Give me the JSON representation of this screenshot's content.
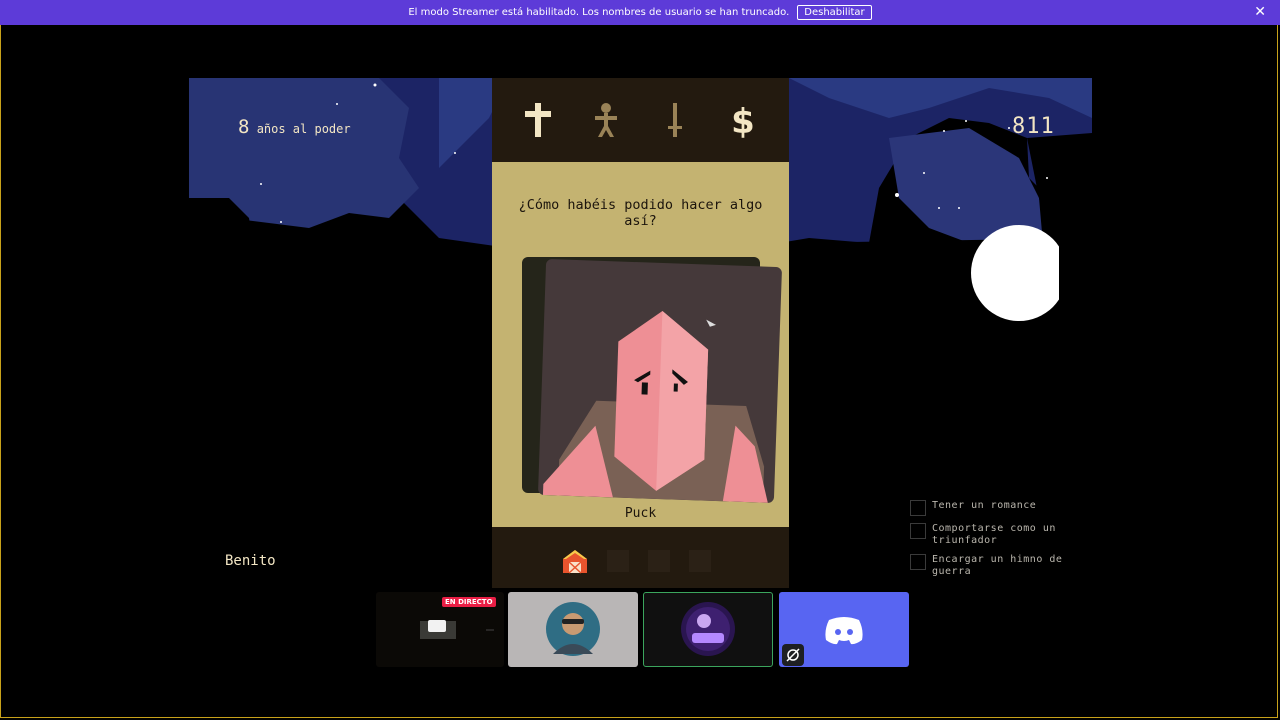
{
  "banner": {
    "message": "El modo Streamer está habilitado. Los nombres de usuario se han truncado.",
    "disable_label": "Deshabilitar",
    "close_icon": "close-icon",
    "color": "#5d3bd8"
  },
  "hud": {
    "years_number": "8",
    "years_label": "años al poder",
    "score": "811"
  },
  "stats": [
    {
      "name": "church",
      "icon": "cross-icon"
    },
    {
      "name": "people",
      "icon": "person-icon"
    },
    {
      "name": "army",
      "icon": "sword-icon"
    },
    {
      "name": "money",
      "icon": "dollar-icon"
    }
  ],
  "card": {
    "question": "¿Cómo habéis podido hacer algo así?",
    "character_name": "Puck"
  },
  "player": {
    "name": "Benito"
  },
  "objectives": [
    {
      "label": "Tener un romance",
      "done": false
    },
    {
      "label": "Comportarse como un triunfador",
      "done": false
    },
    {
      "label": "Encargar un himno de guerra",
      "done": false
    }
  ],
  "participants": {
    "live_badge": "EN DIRECTO"
  },
  "colors": {
    "sky": "#1c2465",
    "panel_dark": "#231a0f",
    "panel_tan": "#c4b371",
    "card_bg": "#45393a",
    "skin": "#ee8f95",
    "discord": "#5865f2"
  }
}
